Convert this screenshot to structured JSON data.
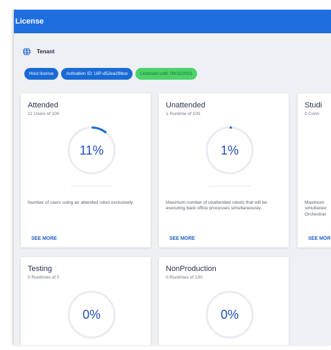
{
  "header": {
    "title": "License"
  },
  "tenant": {
    "label": "Tenant",
    "icon": "globe-icon"
  },
  "badges": {
    "host_license": "Host license",
    "activation_id": "Activation ID: UiP-d52ea29bce",
    "licensed_until": "Licensed until: 09/11/2021"
  },
  "colors": {
    "header": "#1e6ee0",
    "accent": "#1a6ad6",
    "licensed_green": "#4bd26a",
    "gauge_track": "#e9ecf0"
  },
  "cards": [
    {
      "title": "Attended",
      "subtitle": "11 Users of 100",
      "percent_text": "11%",
      "percent": 0.11,
      "description": "Number of users using an attended robot exclusively.",
      "see_more": "SEE MORE"
    },
    {
      "title": "Unattended",
      "subtitle": "1 Runtime of 100",
      "percent_text": "1%",
      "percent": 0.01,
      "description": "Maximum number of unattended robots that will be executing back office processes simultaneously.",
      "see_more": "SEE MORE"
    },
    {
      "title": "Studi",
      "subtitle": "0 Conn",
      "description": "Maximum simultaneo Orchestrat",
      "see_more": "SEE MOR"
    },
    {
      "title": "Testing",
      "subtitle": "0 Runtimes of 0",
      "percent_text": "0%",
      "percent": 0
    },
    {
      "title": "NonProduction",
      "subtitle": "0 Runtimes of 100",
      "percent_text": "0%",
      "percent": 0
    }
  ]
}
